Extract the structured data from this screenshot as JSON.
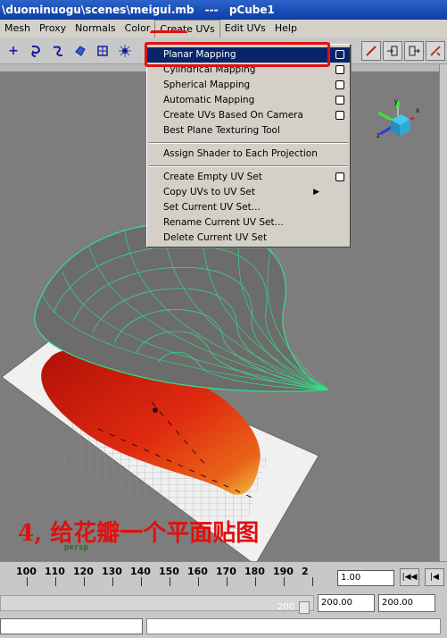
{
  "window": {
    "path": "\\duominuogu\\scenes\\meigui.mb",
    "separator": "---",
    "object": "pCube1"
  },
  "menubar": {
    "items": [
      "Mesh",
      "Proxy",
      "Normals",
      "Color",
      "Create UVs",
      "Edit UVs",
      "Help"
    ],
    "active": "Create UVs"
  },
  "toolbar": {
    "icons": [
      "plus-icon",
      "lasso-icon",
      "curve-icon",
      "paint-icon",
      "grid-icon",
      "sparkle-icon"
    ],
    "right_icons": [
      "pin-icon",
      "import-icon",
      "export-icon",
      "settings-icon"
    ]
  },
  "dropdown": {
    "items": [
      {
        "label": "Planar Mapping",
        "option_box": true,
        "selected": true
      },
      {
        "label": "Cylindrical Mapping",
        "option_box": true
      },
      {
        "label": "Spherical Mapping",
        "option_box": true
      },
      {
        "label": "Automatic Mapping",
        "option_box": true
      },
      {
        "label": "Create UVs Based On Camera",
        "option_box": true
      },
      {
        "label": "Best Plane Texturing Tool",
        "option_box": false
      }
    ],
    "group2": [
      {
        "label": "Assign Shader to Each Projection",
        "option_box": false
      }
    ],
    "group3": [
      {
        "label": "Create Empty UV Set",
        "option_box": true
      },
      {
        "label": "Copy UVs to UV Set",
        "submenu": true
      },
      {
        "label": "Set Current UV Set...",
        "option_box": false
      },
      {
        "label": "Rename Current UV Set...",
        "option_box": false
      },
      {
        "label": "Delete Current UV Set",
        "option_box": false
      }
    ]
  },
  "viewport": {
    "camera": "persp",
    "caption": "4, 给花瓣一个平面贴图",
    "gizmo_axes": [
      "y",
      "x",
      "z"
    ],
    "colors": {
      "background": "#7d7d7d",
      "wireframe": "#32e08a",
      "petal": "#d82010",
      "annotation": "#e01010"
    }
  },
  "timeline": {
    "ticks": [
      "100",
      "110",
      "120",
      "130",
      "140",
      "150",
      "160",
      "170",
      "180",
      "190",
      "2"
    ],
    "current_time": "1.00"
  },
  "range": {
    "end_label": "200",
    "start_field": "200.00",
    "end_field": "200.00"
  }
}
